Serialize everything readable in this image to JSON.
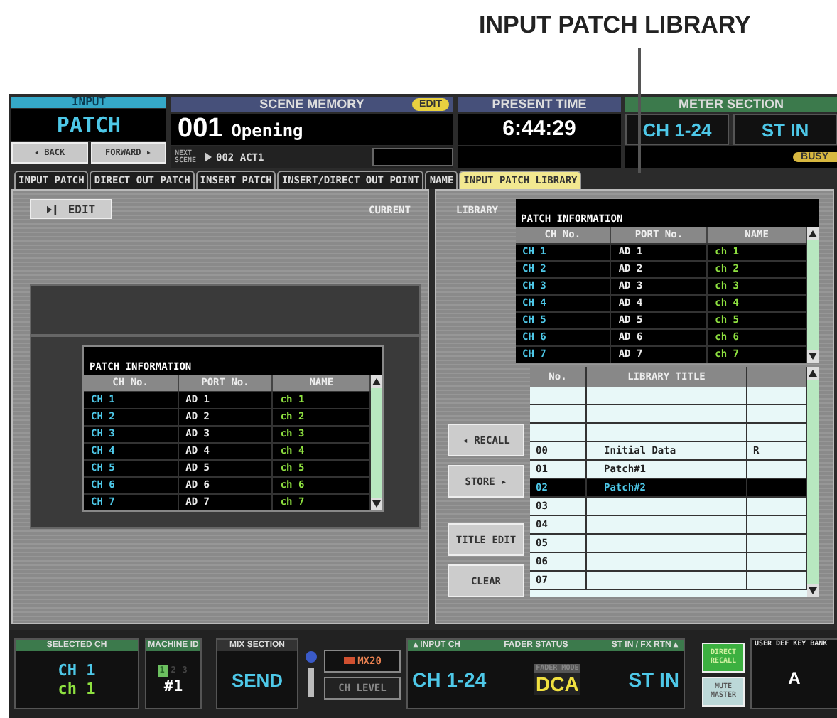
{
  "callout": {
    "label": "INPUT PATCH LIBRARY"
  },
  "function_display": {
    "category": "INPUT",
    "name": "PATCH",
    "back": "◂ BACK",
    "forward": "FORWARD ▸"
  },
  "scene_memory": {
    "title": "SCENE MEMORY",
    "badge": "EDIT",
    "number": "001",
    "name": "Opening",
    "next_label": "NEXT SCENE",
    "next_scene": "002 ACT1"
  },
  "present_time": {
    "title": "PRESENT TIME",
    "time": "6:44:29"
  },
  "meter_section": {
    "title": "METER SECTION",
    "buttons": [
      "CH 1-24",
      "ST IN"
    ],
    "busy": "BUSY"
  },
  "tabs": [
    {
      "label": "INPUT PATCH",
      "selected": false
    },
    {
      "label": "DIRECT OUT PATCH",
      "selected": false
    },
    {
      "label": "INSERT PATCH",
      "selected": false
    },
    {
      "label": "INSERT/DIRECT OUT POINT",
      "selected": false
    },
    {
      "label": "NAME",
      "selected": false
    },
    {
      "label": "INPUT PATCH LIBRARY",
      "selected": true
    }
  ],
  "current": {
    "edit_button": "EDIT",
    "label": "CURRENT",
    "patch_info": {
      "title": "PATCH INFORMATION",
      "columns": [
        "CH No.",
        "PORT No.",
        "NAME"
      ],
      "rows": [
        {
          "ch": "CH 1",
          "port": "AD 1",
          "name": "ch 1"
        },
        {
          "ch": "CH 2",
          "port": "AD 2",
          "name": "ch 2"
        },
        {
          "ch": "CH 3",
          "port": "AD 3",
          "name": "ch 3"
        },
        {
          "ch": "CH 4",
          "port": "AD 4",
          "name": "ch 4"
        },
        {
          "ch": "CH 5",
          "port": "AD 5",
          "name": "ch 5"
        },
        {
          "ch": "CH 6",
          "port": "AD 6",
          "name": "ch 6"
        },
        {
          "ch": "CH 7",
          "port": "AD 7",
          "name": "ch 7"
        }
      ]
    }
  },
  "library": {
    "label": "LIBRARY",
    "patch_info": {
      "title": "PATCH INFORMATION",
      "columns": [
        "CH No.",
        "PORT No.",
        "NAME"
      ],
      "rows": [
        {
          "ch": "CH 1",
          "port": "AD 1",
          "name": "ch 1"
        },
        {
          "ch": "CH 2",
          "port": "AD 2",
          "name": "ch 2"
        },
        {
          "ch": "CH 3",
          "port": "AD 3",
          "name": "ch 3"
        },
        {
          "ch": "CH 4",
          "port": "AD 4",
          "name": "ch 4"
        },
        {
          "ch": "CH 5",
          "port": "AD 5",
          "name": "ch 5"
        },
        {
          "ch": "CH 6",
          "port": "AD 6",
          "name": "ch 6"
        },
        {
          "ch": "CH 7",
          "port": "AD 7",
          "name": "ch 7"
        }
      ]
    },
    "buttons": [
      {
        "label": "◂ RECALL",
        "kind": "recall"
      },
      {
        "label": "STORE ▸",
        "kind": "store"
      },
      {
        "label": "TITLE EDIT",
        "kind": "title"
      },
      {
        "label": "CLEAR",
        "kind": "clear"
      }
    ],
    "list": {
      "columns": [
        "No.",
        "LIBRARY TITLE"
      ],
      "rows": [
        {
          "number": "00",
          "title": "Initial Data",
          "flag": "R",
          "selected": false
        },
        {
          "number": "01",
          "title": "Patch#1",
          "selected": false
        },
        {
          "number": "02",
          "title": "Patch#2",
          "selected": true
        },
        {
          "number": "03",
          "selected": false
        },
        {
          "number": "04",
          "selected": false
        },
        {
          "number": "05",
          "selected": false
        },
        {
          "number": "06",
          "selected": false
        },
        {
          "number": "07",
          "selected": false
        }
      ]
    }
  },
  "status_bar": {
    "selected_ch": {
      "title": "SELECTED CH",
      "channel": "CH 1",
      "name": "ch 1"
    },
    "machine_id": {
      "title": "MACHINE ID",
      "indicators": [
        {
          "label": "1",
          "on": true
        },
        {
          "label": "2",
          "on": false
        },
        {
          "label": "3",
          "on": false
        }
      ],
      "value": "#1"
    },
    "mix_section": {
      "title": "MIX SECTION",
      "value": "SEND",
      "mix": "MX20",
      "level": "CH LEVEL"
    },
    "fader_status": {
      "input_label": "▴ INPUT CH",
      "title": "FADER STATUS",
      "stin_label": "ST IN / FX RTN ▴",
      "input_value": "CH 1-24",
      "mode_label": "FADER MODE",
      "mode": "DCA",
      "stin_value": "ST IN"
    },
    "direct_recall": {
      "label": "DIRECT RECALL",
      "on": true
    },
    "mute_master": {
      "label": "MUTE MASTER",
      "on": false
    },
    "user_def": {
      "title": "USER DEF KEY BANK",
      "value": "A"
    }
  }
}
